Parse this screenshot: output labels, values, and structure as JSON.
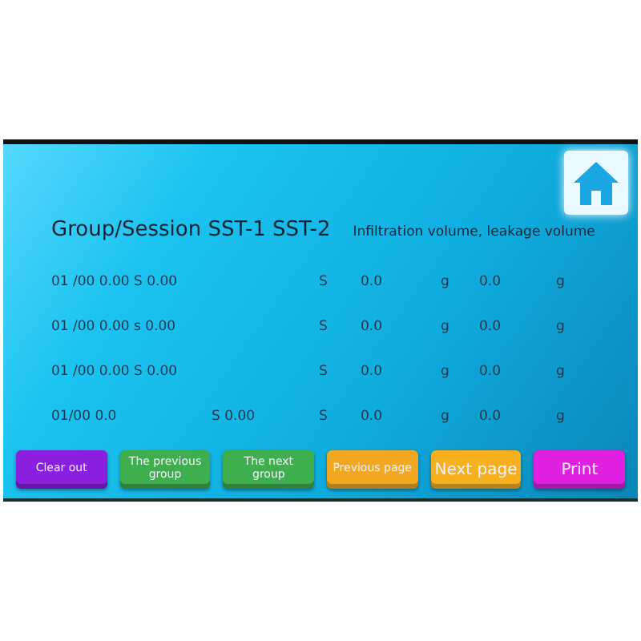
{
  "header": {
    "title": "Group/Session SST-1 SST-2",
    "subtitle": "Infiltration volume, leakage volume"
  },
  "rows": [
    {
      "cells": [
        "01 /00 0.00 S 0.00",
        "",
        "S",
        "0.0",
        "g",
        "0.0",
        "g"
      ]
    },
    {
      "cells": [
        "01 /00 0.00 s 0.00",
        "",
        "S",
        "0.0",
        "g",
        "0.0",
        "g"
      ]
    },
    {
      "cells": [
        "01 /00 0.00 S 0.00",
        "",
        "S",
        "0.0",
        "g",
        "0.0",
        "g"
      ]
    },
    {
      "cells": [
        "01/00 0.0",
        "S 0.00",
        "S",
        "0.0",
        "g",
        "0.0",
        "g"
      ]
    }
  ],
  "buttons": [
    {
      "label": "Clear out",
      "color": "#8a1fe0"
    },
    {
      "label": "The previous group",
      "color": "#3fae4f"
    },
    {
      "label": "The next group",
      "color": "#3fae4f"
    },
    {
      "label": "Previous page",
      "color": "#f0a820"
    },
    {
      "label": "Next page",
      "color": "#f5b020"
    },
    {
      "label": "Print",
      "color": "#e020e0"
    }
  ]
}
